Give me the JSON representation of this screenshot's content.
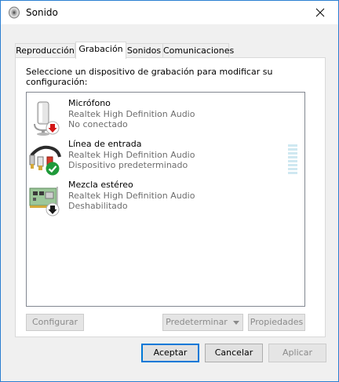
{
  "window": {
    "title": "Sonido"
  },
  "tabs": [
    {
      "label": "Reproducción"
    },
    {
      "label": "Grabación"
    },
    {
      "label": "Sonidos"
    },
    {
      "label": "Comunicaciones"
    }
  ],
  "active_tab": "Grabación",
  "panel": {
    "instruction": "Seleccione un dispositivo de grabación para modificar su configuración:"
  },
  "devices": [
    {
      "name": "Micrófono",
      "driver": "Realtek High Definition Audio",
      "status": "No conectado",
      "icon": "microphone-icon",
      "badge": "red-down-arrow-icon"
    },
    {
      "name": "Línea de entrada",
      "driver": "Realtek High Definition Audio",
      "status": "Dispositivo predeterminado",
      "icon": "line-in-cable-icon",
      "badge": "green-check-icon"
    },
    {
      "name": "Mezcla estéreo",
      "driver": "Realtek High Definition Audio",
      "status": "Deshabilitado",
      "icon": "sound-card-icon",
      "badge": "black-down-arrow-icon"
    }
  ],
  "panel_buttons": {
    "configure": "Configurar",
    "set_default": "Predeterminar",
    "properties": "Propiedades"
  },
  "footer_buttons": {
    "ok": "Aceptar",
    "cancel": "Cancelar",
    "apply": "Aplicar"
  },
  "colors": {
    "accent": "#0078d7",
    "window_border": "#2b7fd1",
    "disabled_text": "#8a8a8a",
    "secondary_text": "#6d6d6d",
    "level_meter": "#cfe8f1"
  }
}
